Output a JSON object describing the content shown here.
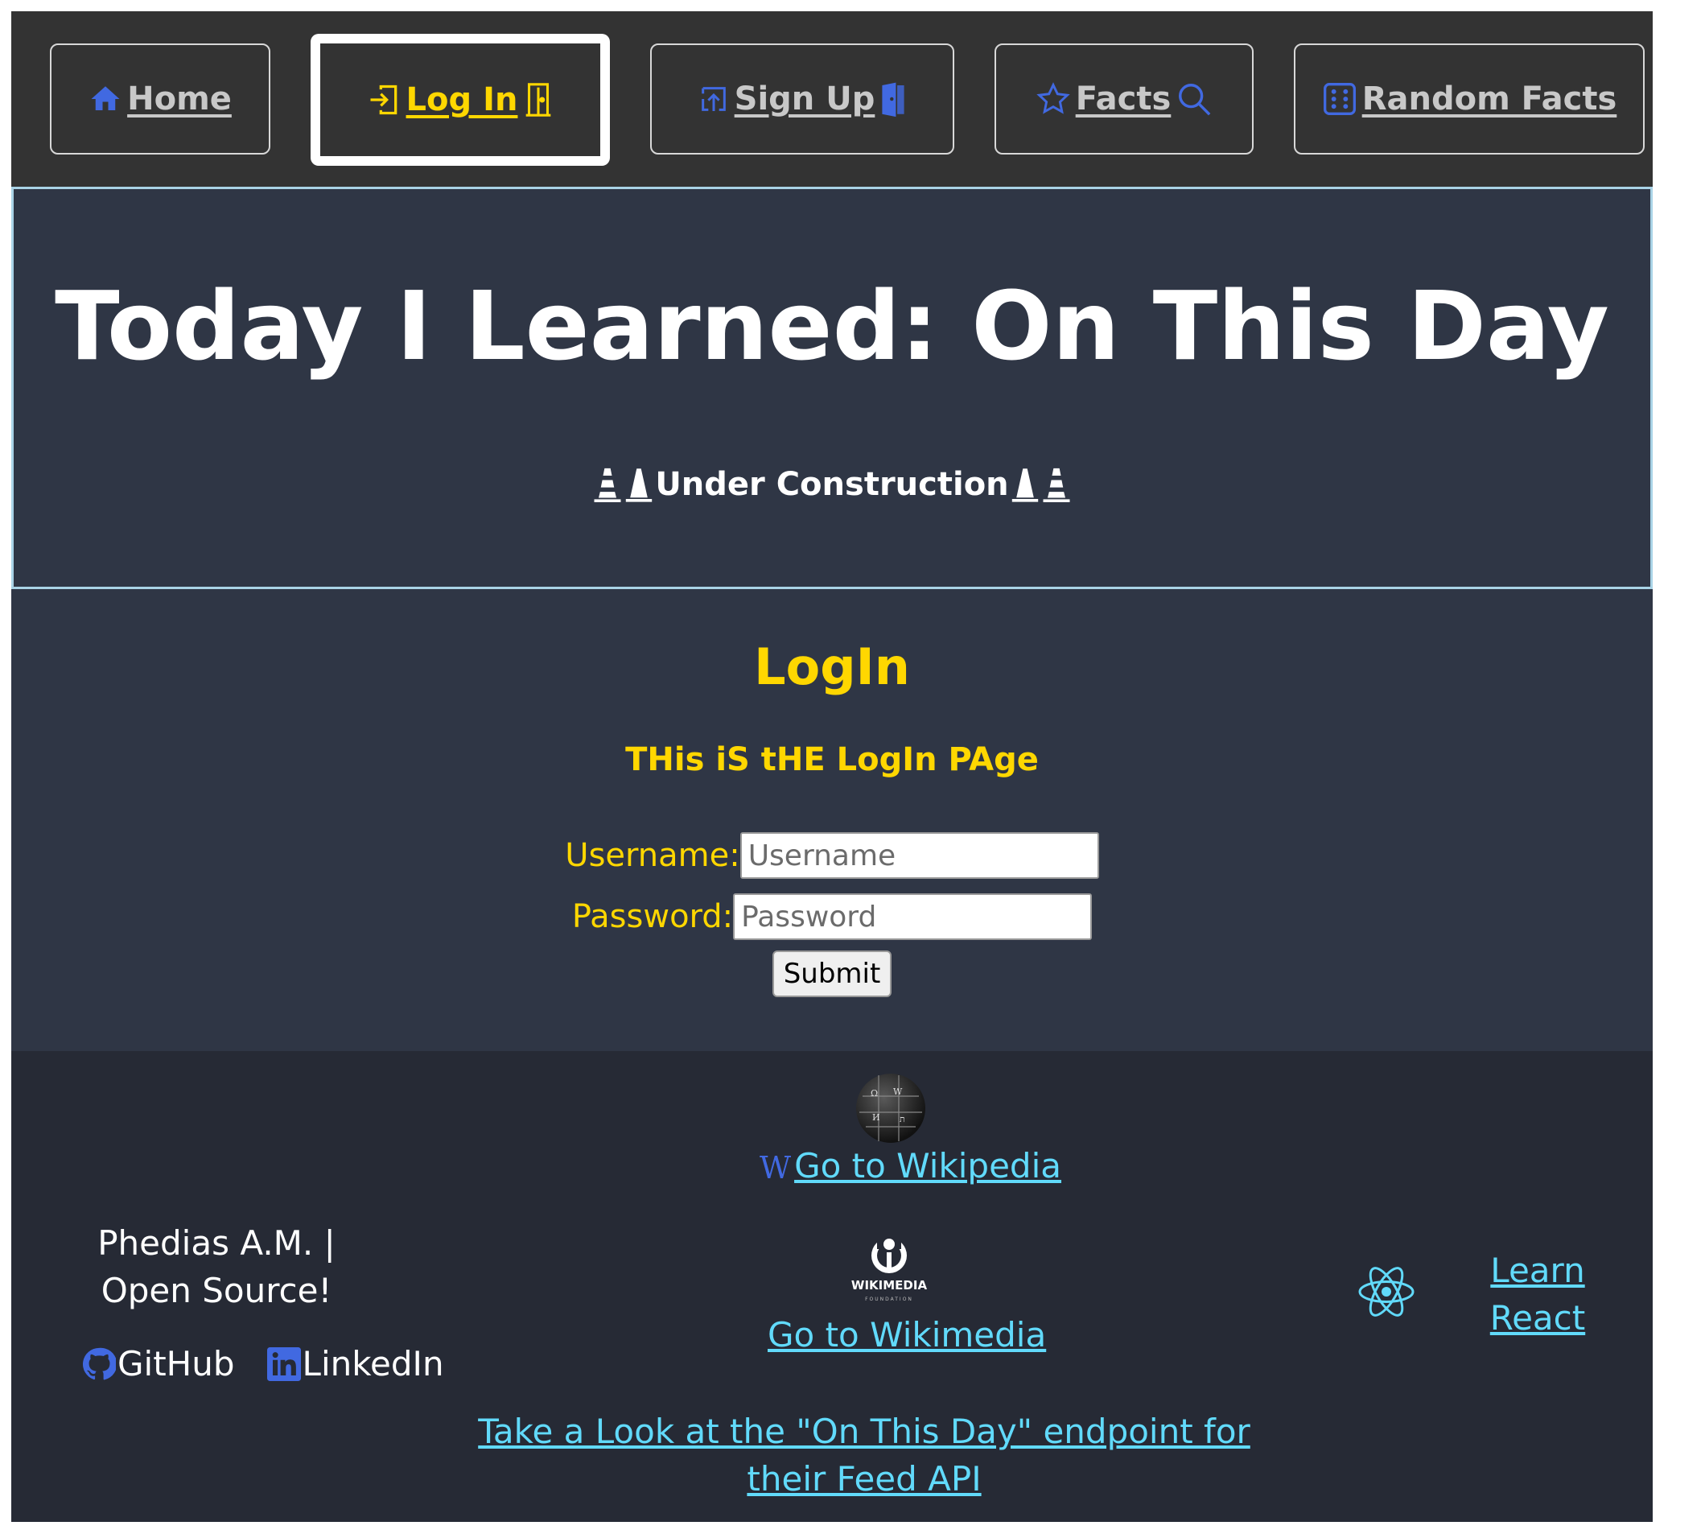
{
  "nav": {
    "items": [
      {
        "label": "Home",
        "icon": "home-icon"
      },
      {
        "label": "Log In",
        "icon": "login-icon",
        "trailing_icon": "door-open-icon",
        "active": true
      },
      {
        "label": "Sign Up",
        "icon": "upload-icon",
        "trailing_icon": "door-icon"
      },
      {
        "label": "Facts",
        "icon": "star-icon",
        "trailing_icon": "search-icon"
      },
      {
        "label": "Random Facts",
        "icon": "dice-icon"
      }
    ]
  },
  "hero": {
    "title": "Today I Learned: On This Day",
    "subtitle": "Under Construction"
  },
  "login": {
    "heading": "LogIn",
    "subheading": "THis iS tHE LogIn PAge",
    "username_label": "Username:",
    "username_placeholder": "Username",
    "password_label": "Password:",
    "password_placeholder": "Password",
    "submit_label": "Submit"
  },
  "footer": {
    "wiki_prefix": "W",
    "wikipedia_link": "Go to Wikipedia",
    "wikimedia_logo_text": "WIKIMEDIA",
    "wikimedia_logo_sub": "FOUNDATION",
    "wikimedia_link": "Go to Wikimedia",
    "feed_link": "Take a Look at the \"On This Day\" endpoint for their Feed API",
    "credit": "Phedias A.M. | Open Source!",
    "github_label": "GitHub",
    "linkedin_label": "LinkedIn",
    "learn_react": "Learn React"
  },
  "colors": {
    "nav_bg": "#333333",
    "panel_bg": "#2f3645",
    "footer_bg": "#262a35",
    "accent": "#ffd700",
    "icon_blue": "#4169e1",
    "link": "#61dafb"
  }
}
